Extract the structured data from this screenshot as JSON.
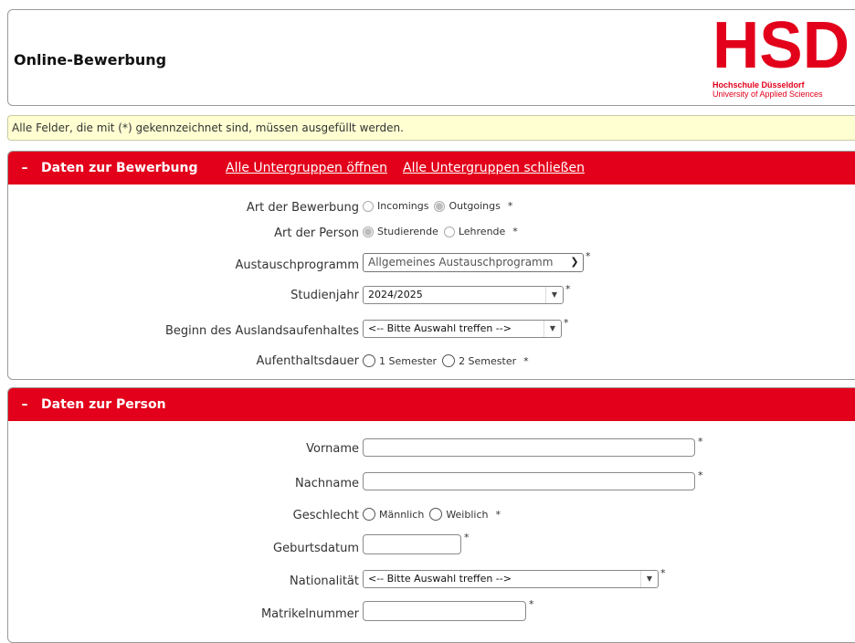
{
  "header": {
    "title": "Online-Bewerbung",
    "logo_text": "HSD",
    "logo_line1": "Hochschule Düsseldorf",
    "logo_line2": "University of Applied Sciences",
    "brand_color": "#e2001a"
  },
  "notice": "Alle Felder, die mit (*) gekennzeichnet sind, müssen ausgefüllt werden.",
  "section1": {
    "toggle": "–",
    "title": "Daten zur Bewerbung",
    "open_all": "Alle Untergruppen öffnen",
    "close_all": "Alle Untergruppen schließen",
    "fields": {
      "art_bewerbung": {
        "label": "Art der Bewerbung",
        "options": [
          "Incomings",
          "Outgoings"
        ],
        "selected": "Outgoings"
      },
      "art_person": {
        "label": "Art der Person",
        "options": [
          "Studierende",
          "Lehrende"
        ],
        "selected": "Studierende"
      },
      "austauschprogramm": {
        "label": "Austauschprogramm",
        "value": "Allgemeines Austauschprogramm"
      },
      "studienjahr": {
        "label": "Studienjahr",
        "value": "2024/2025"
      },
      "beginn": {
        "label": "Beginn des Auslandsaufenhaltes",
        "value": "<-- Bitte Auswahl treffen -->"
      },
      "dauer": {
        "label": "Aufenthaltsdauer",
        "options": [
          "1 Semester",
          "2 Semester"
        ]
      }
    }
  },
  "section2": {
    "toggle": "–",
    "title": "Daten zur Person",
    "fields": {
      "vorname": {
        "label": "Vorname",
        "value": ""
      },
      "nachname": {
        "label": "Nachname",
        "value": ""
      },
      "geschlecht": {
        "label": "Geschlecht",
        "options": [
          "Männlich",
          "Weiblich"
        ]
      },
      "geburtsdatum": {
        "label": "Geburtsdatum",
        "value": ""
      },
      "nationalitaet": {
        "label": "Nationalität",
        "value": "<-- Bitte Auswahl treffen -->"
      },
      "matrikelnummer": {
        "label": "Matrikelnummer",
        "value": ""
      }
    }
  },
  "required_marker": "*"
}
